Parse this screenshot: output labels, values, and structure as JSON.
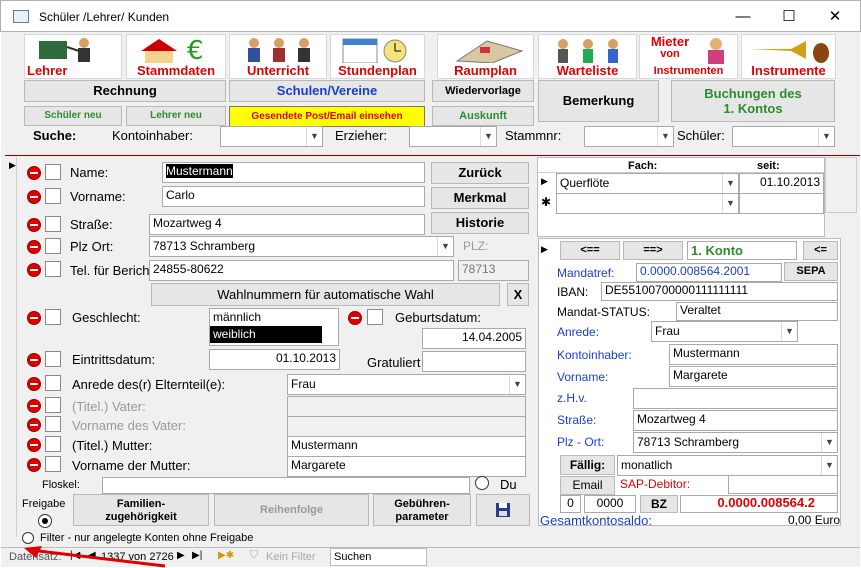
{
  "window": {
    "title": "Schüler /Lehrer/ Kunden",
    "minimize": "—",
    "maximize": "☐",
    "close": "✕"
  },
  "tiles": [
    "Lehrer",
    "Stammdaten",
    "Unterricht",
    "Stundenplan",
    "Raumplan",
    "Warteliste",
    "Mieter von Instrumenten",
    "Instrumente"
  ],
  "tile_mieter": [
    "Mieter",
    "von",
    "Instrumenten"
  ],
  "buttons": {
    "rechnung": "Rechnung",
    "schulen": "Schulen/Vereine",
    "wiedervorlage": "Wiedervorlage",
    "bemerkung": "Bemerkung",
    "buchungen": "Buchungen des",
    "buchungen2": "1. Kontos",
    "schueler_neu": "Schüler neu",
    "lehrer_neu": "Lehrer neu",
    "gesendete": "Gesendete Post/Email einsehen",
    "auskunft": "Auskunft",
    "zurueck": "Zurück",
    "merkmal": "Merkmal",
    "historie": "Historie",
    "wahlnummern": "Wahlnummern für automatische Wahl",
    "x": "X",
    "familien": "Familien-",
    "familien2": "zugehörigkeit",
    "reihenfolge": "Reihenfolge",
    "gebuehren": "Gebühren-",
    "gebuehren2": "parameter",
    "prev": "<==",
    "next": "==>",
    "first": "<=",
    "sepa": "SEPA",
    "faellig": "Fällig:",
    "email": "Email",
    "bz": "BZ"
  },
  "search": {
    "label": "Suche:",
    "kontoinhaber": "Kontoinhaber:",
    "erzieher": "Erzieher:",
    "stammnr": "Stammnr:",
    "schueler": "Schüler:"
  },
  "form": {
    "name_label": "Name:",
    "name": "Mustermann",
    "vorname_label": "Vorname:",
    "vorname": "Carlo",
    "strasse_label": "Straße:",
    "strasse": "Mozartweg 4",
    "plzort_label": "Plz Ort:",
    "plzort": "78713 Schramberg",
    "plz_label": "PLZ:",
    "plz": "78713",
    "tel_label": "Tel. für Berich",
    "tel": "24855-80622",
    "geschlecht_label": "Geschlecht:",
    "geschlecht_opts": [
      "männlich",
      "weiblich"
    ],
    "geburt_label": "Geburtsdatum:",
    "geburt": "14.04.2005",
    "eintritt_label": "Eintrittsdatum:",
    "eintritt": "01.10.2013",
    "gratuliert": "Gratuliert",
    "anrede_label": "Anrede des(r) Elternteil(e):",
    "anrede": "Frau",
    "titel_vater": "(Titel.) Vater:",
    "vorname_vater": "Vorname des Vater:",
    "titel_mutter": "(Titel.) Mutter:",
    "mutter": "Mustermann",
    "vorname_mutter_label": "Vorname der Mutter:",
    "vorname_mutter": "Margarete",
    "floskel": "Floskel:",
    "du": "Du",
    "freigabe": "Freigabe",
    "filter": "Filter - nur angelegte Konten ohne Freigabe"
  },
  "fach": {
    "col_fach": "Fach:",
    "col_seit": "seit:",
    "rows": [
      {
        "fach": "Querflöte",
        "seit": "01.10.2013"
      }
    ],
    "new_marker": "✱"
  },
  "konto": {
    "title": "1. Konto",
    "mandatref_label": "Mandatref:",
    "mandatref": "0.0000.008564.2001",
    "iban_label": "IBAN:",
    "iban": "DE55100700000111111111",
    "mandat_status_label": "Mandat-STATUS:",
    "mandat_status": "Veraltet",
    "anrede_label": "Anrede:",
    "anrede": "Frau",
    "kontoinhaber_label": "Kontoinhaber:",
    "kontoinhaber": "Mustermann",
    "vorname_label": "Vorname:",
    "vorname": "Margarete",
    "zhv_label": "z.H.v.",
    "strasse_label": "Straße:",
    "strasse": "Mozartweg 4",
    "plzort_label": "Plz - Ort:",
    "plzort": "78713 Schramberg",
    "faellig": "monatlich",
    "sap_label": "SAP-Debitor:",
    "n0": "0",
    "n0000": "0000",
    "bz_value": "0.0000.008564.2",
    "saldo_label": "Gesamtkontosaldo:",
    "saldo": "0,00 Euro"
  },
  "nav": {
    "datensatz": "Datensatz:",
    "record": "1337 von 2726",
    "kein_filter": "Kein Filter",
    "suchen": "Suchen"
  }
}
